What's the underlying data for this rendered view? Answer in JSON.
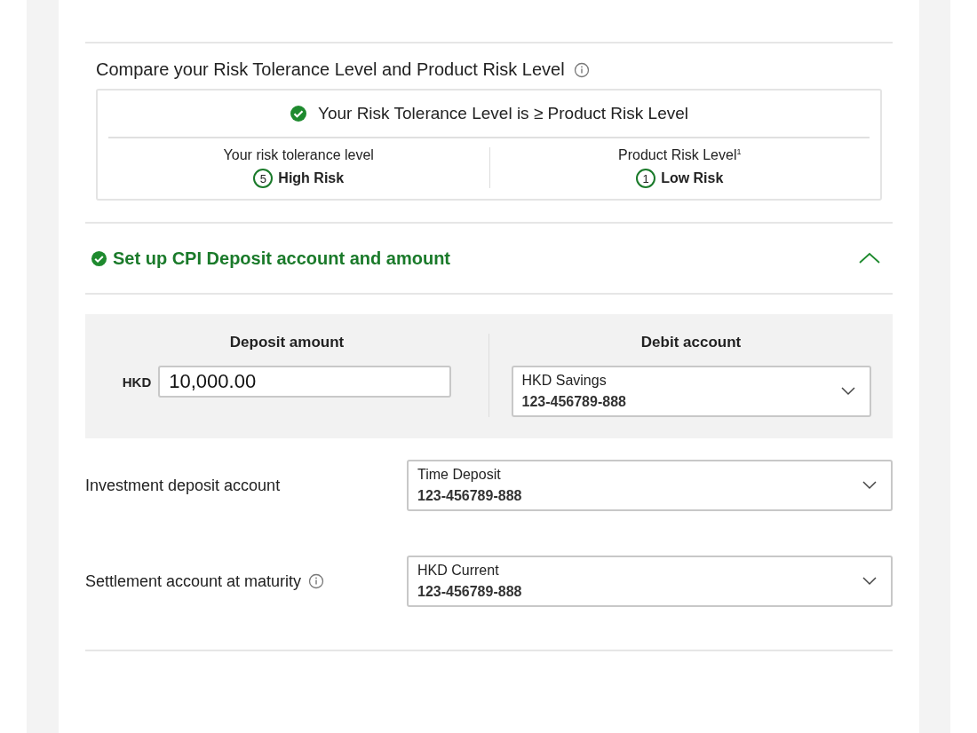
{
  "compare": {
    "title": "Compare your Risk Tolerance Level and Product Risk Level",
    "info": true,
    "result": "Your Risk Tolerance Level is ≥ Product Risk Level",
    "passed": true,
    "levels": [
      {
        "label": "Your risk tolerance level",
        "number": "5",
        "value": "High Risk"
      },
      {
        "label": "Product Risk Level$^{1}$",
        "number": "1",
        "value": "Low Risk"
      }
    ]
  },
  "section": {
    "title": "Set up CPI Deposit account and amount",
    "complete": true,
    "expanded": true
  },
  "deposit": {
    "label": "Deposit amount",
    "currency": "HKD",
    "value": "10,000.00"
  },
  "debit": {
    "label": "Debit account",
    "name": "HKD Savings",
    "number": "123-456789-888"
  },
  "accounts": [
    {
      "label": "Investment deposit account",
      "info": false,
      "name": "Time Deposit",
      "number": "123-456789-888"
    },
    {
      "label": "Settlement account at maturity",
      "info": true,
      "name": "HKD Current",
      "number": "123-456789-888"
    }
  ]
}
